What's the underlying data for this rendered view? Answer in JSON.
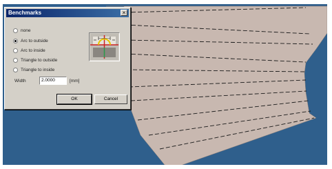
{
  "dialog": {
    "title": "Benchmarks",
    "close_glyph": "×",
    "options": [
      {
        "label": "none",
        "checked": false
      },
      {
        "label": "Arc to outside",
        "checked": true
      },
      {
        "label": "Arc to inside",
        "checked": false
      },
      {
        "label": "Triangle to outside",
        "checked": false
      },
      {
        "label": "Triangle to inside",
        "checked": false
      }
    ],
    "width_label": "Width",
    "width_value": "2.0000",
    "unit": "[mm]",
    "ok_label": "OK",
    "cancel_label": "Cancel"
  },
  "colors": {
    "background": "#2f5f8c",
    "part": "#c8b8b0",
    "dialog": "#d4d0c8",
    "titlebar": "#0a246a"
  }
}
